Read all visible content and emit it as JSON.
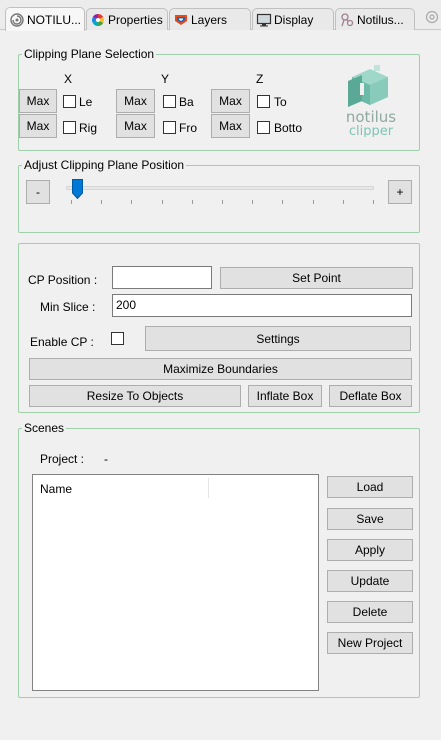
{
  "tabs": [
    {
      "label": "NOTILU...",
      "icon": "notilus-icon"
    },
    {
      "label": "Properties",
      "icon": "color-wheel-icon"
    },
    {
      "label": "Layers",
      "icon": "layers-icon"
    },
    {
      "label": "Display",
      "icon": "monitor-icon"
    },
    {
      "label": "Notilus...",
      "icon": "molecule-icon"
    }
  ],
  "clipping_selection": {
    "title": "Clipping Plane Selection",
    "axis_x": "X",
    "axis_y": "Y",
    "axis_z": "Z",
    "max_label": "Max",
    "x_top": "Le",
    "x_bottom": "Rig",
    "y_top": "Ba",
    "y_bottom": "Fro",
    "z_top": "To",
    "z_bottom": "Botto",
    "logo_word1": "notilus",
    "logo_word2": "clipper"
  },
  "adjust": {
    "title": "Adjust Clipping Plane Position",
    "minus": "-",
    "plus": "+",
    "slider_fraction": 0.02
  },
  "controls": {
    "cp_position_label": "CP Position :",
    "cp_position_value": "",
    "set_point": "Set Point",
    "min_slice_label": "Min Slice :",
    "min_slice_value": "200",
    "enable_cp_label": "Enable CP :",
    "settings": "Settings",
    "maximize_boundaries": "Maximize Boundaries",
    "resize_to_objects": "Resize To Objects",
    "inflate_box": "Inflate Box",
    "deflate_box": "Deflate Box"
  },
  "scenes": {
    "title": "Scenes",
    "project_label": "Project :",
    "project_value": "-",
    "column_name": "Name",
    "buttons": {
      "load": "Load",
      "save": "Save",
      "apply": "Apply",
      "update": "Update",
      "delete": "Delete",
      "new_project": "New Project"
    }
  },
  "colors": {
    "group_border": "#9fcfaa",
    "logo_teal": "#7fc5b4",
    "slider_blue": "#0078d7"
  }
}
